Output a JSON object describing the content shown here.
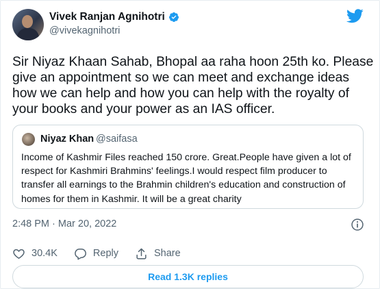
{
  "colors": {
    "accent": "#1d9bf0",
    "text": "#0f1419",
    "muted": "#536471",
    "border": "#cfd9de"
  },
  "author": {
    "name": "Vivek Ranjan Agnihotri",
    "handle": "@vivekagnihotri",
    "verified": true
  },
  "tweet": {
    "text": "Sir Niyaz Khaan Sahab, Bhopal aa raha hoon 25th ko. Please give an appointment so we can meet and exchange ideas how we can help and how you can help with the royalty of your books and your power as an IAS officer.",
    "timestamp": "2:48 PM · Mar 20, 2022"
  },
  "quoted": {
    "name": "Niyaz Khan",
    "handle": "@saifasa",
    "text": "Income of Kashmir Files reached 150 crore. Great.People have given a lot of respect for Kashmiri Brahmins' feelings.I would respect film producer to transfer all earnings to the Brahmin children's education and construction of homes for them in Kashmir. It will be a great charity"
  },
  "actions": {
    "like_count": "30.4K",
    "reply_label": "Reply",
    "share_label": "Share"
  },
  "read_replies_label": "Read 1.3K replies",
  "icons": [
    "twitter-bird-icon",
    "verified-badge-icon",
    "info-icon",
    "heart-icon",
    "reply-icon",
    "share-icon"
  ]
}
